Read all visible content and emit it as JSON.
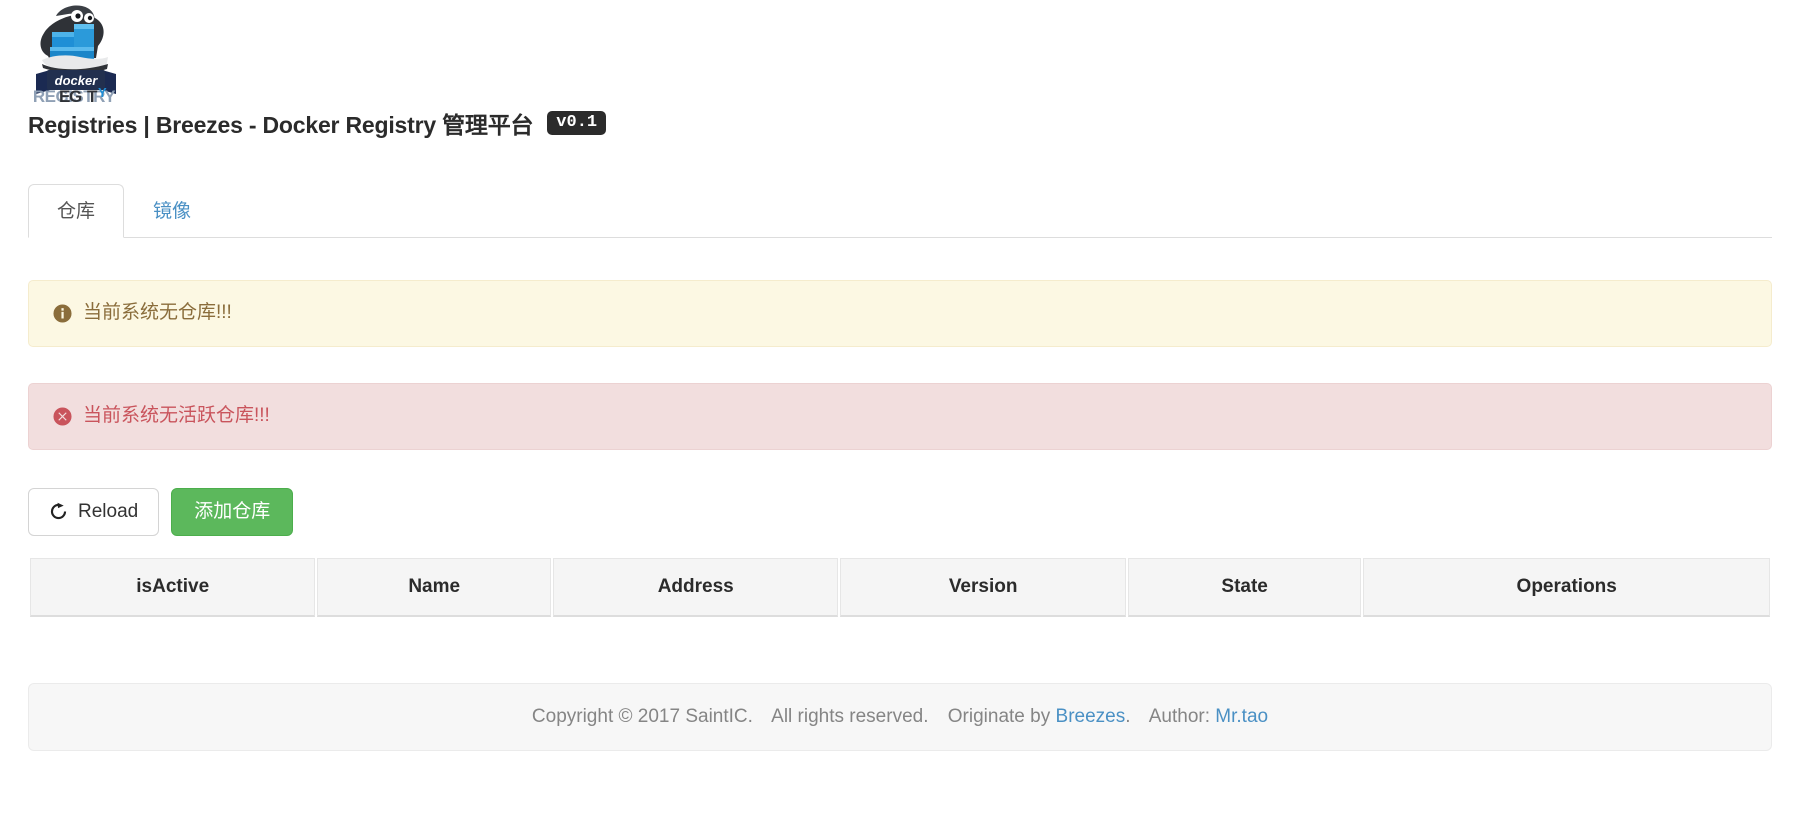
{
  "header": {
    "logo_icon": "docker-registry-logo",
    "logo_wordmark_top": "docker",
    "logo_wordmark_bottom": "REGISTRY",
    "title": "Registries | Breezes - Docker Registry 管理平台",
    "version_badge": "v0.1"
  },
  "tabs": [
    {
      "label": "仓库",
      "name": "tab-repositories",
      "active": true
    },
    {
      "label": "镜像",
      "name": "tab-images",
      "active": false
    }
  ],
  "alerts": [
    {
      "type": "warning",
      "icon": "info-circle-icon",
      "message": "当前系统无仓库!!!",
      "bg_color": "#fcf8e3",
      "text_color": "#8a6d3b"
    },
    {
      "type": "danger",
      "icon": "times-circle-icon",
      "message": "当前系统无活跃仓库!!!",
      "bg_color": "#f2dede",
      "text_color": "#c9545c"
    }
  ],
  "toolbar": {
    "reload_label": "Reload",
    "reload_icon": "refresh-icon",
    "add_registry_label": "添加仓库",
    "add_registry_color": "#5cb85c"
  },
  "table": {
    "columns": [
      "isActive",
      "Name",
      "Address",
      "Version",
      "State",
      "Operations"
    ],
    "rows": []
  },
  "footer": {
    "copyright": "Copyright © 2017 SaintIC.",
    "rights": "All rights reserved.",
    "originate_prefix": "Originate by",
    "originate_link": "Breezes",
    "originate_suffix": ".",
    "author_prefix": "Author:",
    "author_link": "Mr.tao",
    "link_color": "#4a90c4"
  }
}
